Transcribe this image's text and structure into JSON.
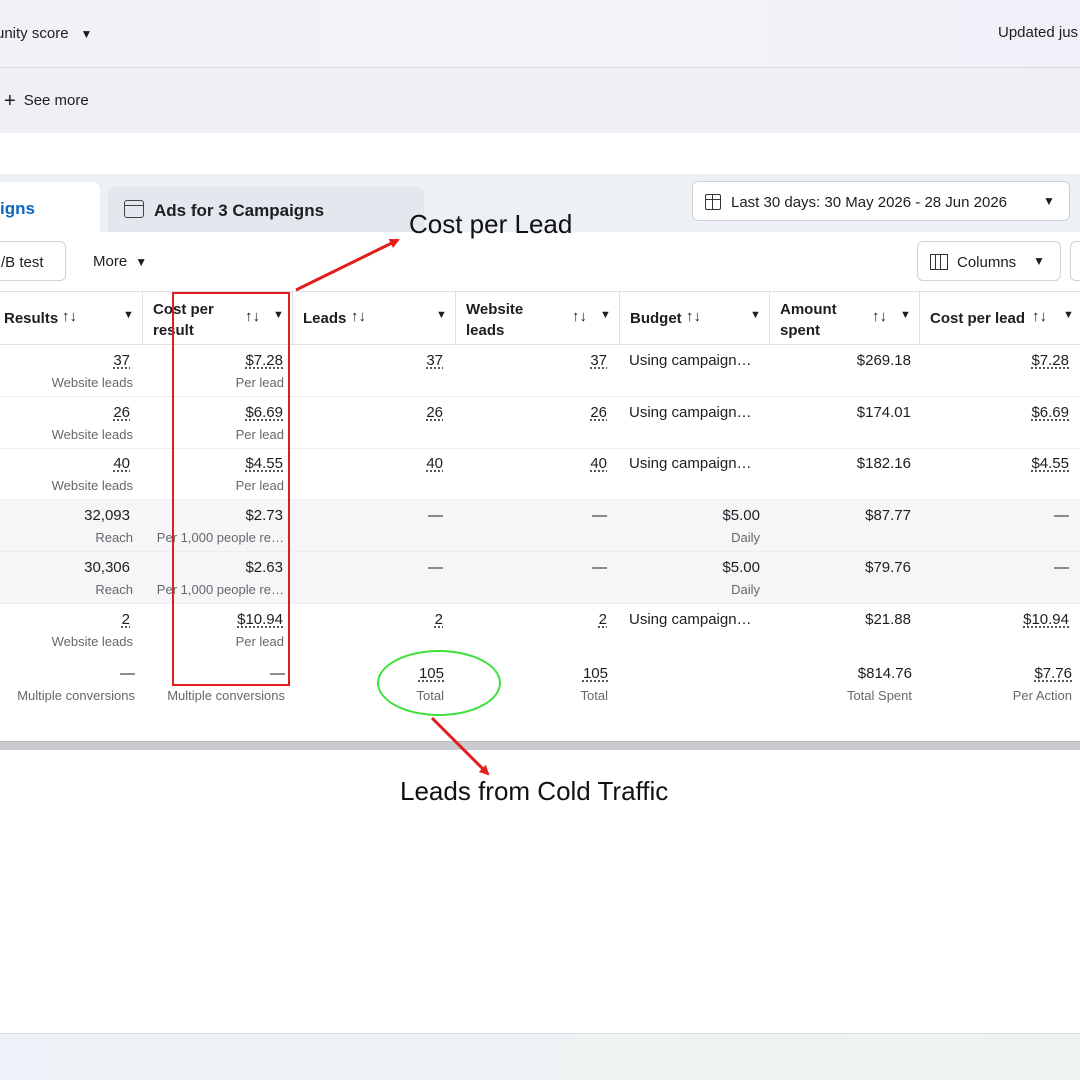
{
  "top": {
    "opportunity_label": "unity score",
    "updated_label": "Updated jus",
    "see_more": "See more"
  },
  "tabs": {
    "active_label": "igns",
    "inactive_label": "Ads for 3 Campaigns"
  },
  "date_range": {
    "label": "Last 30 days: 30 May 2026 - 28 Jun 2026"
  },
  "toolbar": {
    "ab_test_label": "/B test",
    "more_label": "More",
    "columns_label": "Columns"
  },
  "table": {
    "headers": {
      "results": "Results",
      "cost_per_result_line1": "Cost per",
      "cost_per_result_line2": "result",
      "leads": "Leads",
      "website_leads_line1": "Website",
      "website_leads_line2": "leads",
      "budget": "Budget",
      "amount_spent_line1": "Amount",
      "amount_spent_line2": "spent",
      "cost_per_lead": "Cost per lead"
    },
    "rows": [
      {
        "results": "37",
        "results_sub": "Website leads",
        "cpr": "$7.28",
        "cpr_sub": "Per lead",
        "leads": "37",
        "website_leads": "37",
        "budget": "Using campaign…",
        "budget_sub": "",
        "spent": "$269.18",
        "cpl": "$7.28"
      },
      {
        "results": "26",
        "results_sub": "Website leads",
        "cpr": "$6.69",
        "cpr_sub": "Per lead",
        "leads": "26",
        "website_leads": "26",
        "budget": "Using campaign…",
        "budget_sub": "",
        "spent": "$174.01",
        "cpl": "$6.69"
      },
      {
        "results": "40",
        "results_sub": "Website leads",
        "cpr": "$4.55",
        "cpr_sub": "Per lead",
        "leads": "40",
        "website_leads": "40",
        "budget": "Using campaign…",
        "budget_sub": "",
        "spent": "$182.16",
        "cpl": "$4.55"
      },
      {
        "results": "32,093",
        "results_sub": "Reach",
        "cpr": "$2.73",
        "cpr_sub": "Per 1,000 people re…",
        "leads": "—",
        "website_leads": "—",
        "budget": "$5.00",
        "budget_sub": "Daily",
        "spent": "$87.77",
        "cpl": "—"
      },
      {
        "results": "30,306",
        "results_sub": "Reach",
        "cpr": "$2.63",
        "cpr_sub": "Per 1,000 people re…",
        "leads": "—",
        "website_leads": "—",
        "budget": "$5.00",
        "budget_sub": "Daily",
        "spent": "$79.76",
        "cpl": "—"
      },
      {
        "results": "2",
        "results_sub": "Website leads",
        "cpr": "$10.94",
        "cpr_sub": "Per lead",
        "leads": "2",
        "website_leads": "2",
        "budget": "Using campaign…",
        "budget_sub": "",
        "spent": "$21.88",
        "cpl": "$10.94"
      }
    ],
    "totals": {
      "results": "—",
      "results_sub": "Multiple conversions",
      "cpr": "—",
      "cpr_sub": "Multiple conversions",
      "leads": "105",
      "leads_sub": "Total",
      "website_leads": "105",
      "website_leads_sub": "Total",
      "spent": "$814.76",
      "spent_sub": "Total Spent",
      "cpl": "$7.76",
      "cpl_sub": "Per Action"
    }
  },
  "annotations": {
    "cost_per_lead": "Cost per Lead",
    "leads_cold_traffic": "Leads from Cold Traffic"
  },
  "colors": {
    "accent_blue": "#0a66c2",
    "annotation_red": "#e01e1e",
    "annotation_green": "#3ee03a"
  },
  "sort_glyph": "↑↓",
  "caret_glyph": "▼"
}
